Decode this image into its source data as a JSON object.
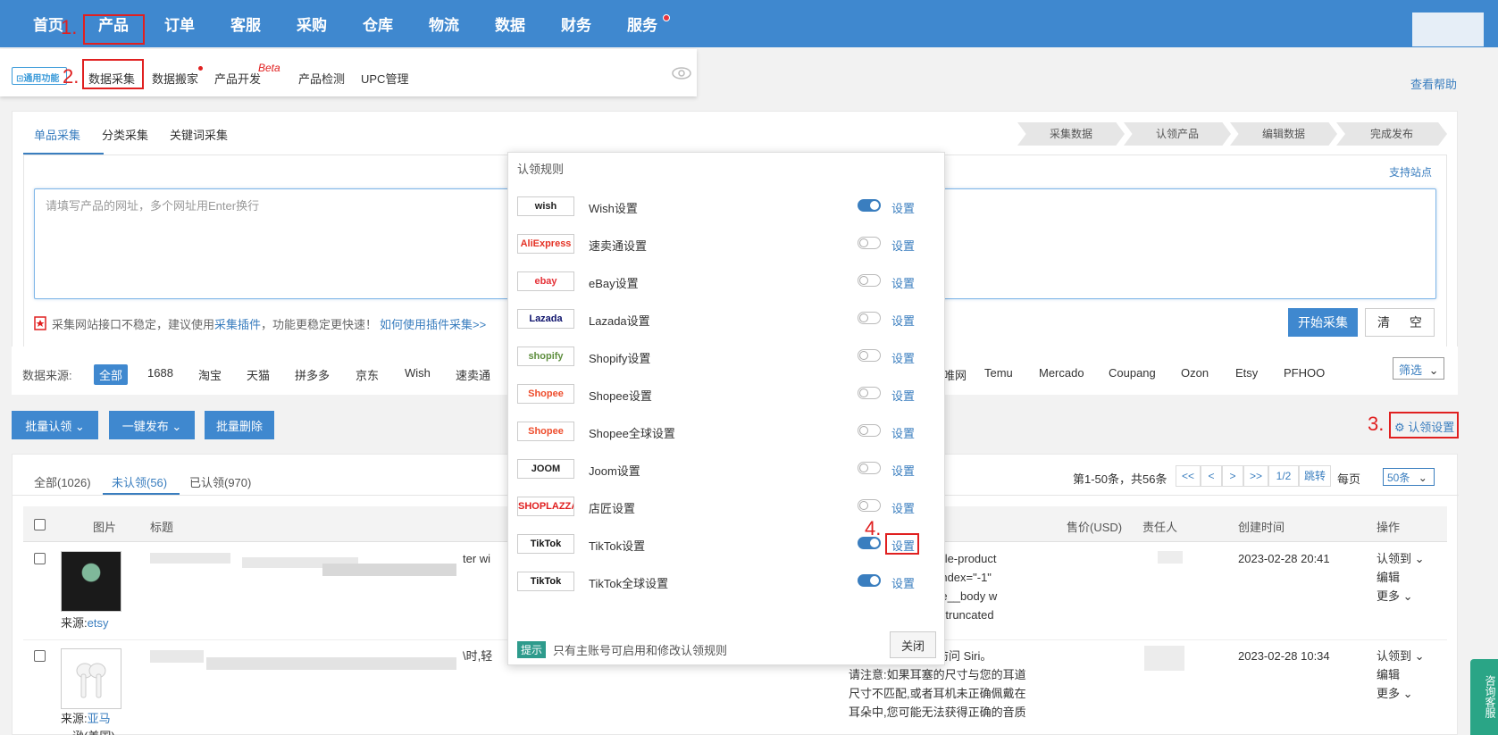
{
  "topnav": {
    "items": [
      "首页",
      "产品",
      "订单",
      "客服",
      "采购",
      "仓库",
      "物流",
      "数据",
      "财务",
      "服务"
    ]
  },
  "steps_markers": {
    "s1": "1.",
    "s2": "2.",
    "s3": "3.",
    "s4": "4."
  },
  "submenu": {
    "general_label": "通用功能",
    "items": [
      "数据采集",
      "数据搬家",
      "产品开发",
      "产品检测",
      "UPC管理"
    ],
    "beta": "Beta",
    "help": "查看帮助"
  },
  "collect": {
    "tabs": [
      "单品采集",
      "分类采集",
      "关键词采集"
    ],
    "steps": [
      "采集数据",
      "认领产品",
      "编辑数据",
      "完成发布"
    ],
    "supported_sites": "支持站点",
    "url_placeholder": "请填写产品的网址，多个网址用Enter换行",
    "notice_prefix": "采集网站接口不稳定，建议使用",
    "notice_link": "采集插件",
    "notice_suffix": "，功能更稳定更快速！",
    "notice_how": "如何使用插件采集>>",
    "start_btn": "开始采集",
    "clear_btn": "清 空"
  },
  "sources": {
    "label": "数据来源:",
    "items_left": [
      "全部",
      "1688",
      "淘宝",
      "天猫",
      "拼多多",
      "京东",
      "Wish",
      "速卖通"
    ],
    "items_right": [
      "唯网",
      "Temu",
      "Mercado",
      "Coupang",
      "Ozon",
      "Etsy",
      "PFHOO"
    ],
    "filter": "筛选"
  },
  "actions": {
    "batch_claim": "批量认领",
    "one_click_publish": "一键发布",
    "batch_delete": "批量删除",
    "claim_settings": "认领设置"
  },
  "list": {
    "tabs": [
      "全部(1026)",
      "未认领(56)",
      "已认领(970)"
    ],
    "page_info": "第1-50条，共56条",
    "pager": [
      "<<",
      "<",
      ">",
      ">>"
    ],
    "page_num": "1/2",
    "jump": "跳转",
    "per_page_label": "每页",
    "per_page_value": "50条",
    "headers": [
      "图片",
      "标题",
      "售价(USD)",
      "责任人",
      "创建时间",
      "操作"
    ],
    "rows": [
      {
        "source_label": "来源:",
        "source": "etsy",
        "title_fragment": "ter wi",
        "desc": [
          "oggle-product",
          "abindex=\"-1\"",
          "ggle__body w",
          "dy--truncated"
        ],
        "created": "2023-02-28 20:41",
        "ops": [
          "认领到",
          "编辑",
          "更多"
        ]
      },
      {
        "source_label": "来源:",
        "source": "亚马",
        "source_2": "逊(美国)",
        "title_fragment": "\\时,轻",
        "desc": [
          "速访问 Siri。",
          "请注意:如果耳塞的尺寸与您的耳道",
          "尺寸不匹配,或者耳机未正确佩戴在",
          "耳朵中,您可能无法获得正确的音质"
        ],
        "created": "2023-02-28 10:34",
        "ops": [
          "认领到",
          "编辑",
          "更多"
        ]
      }
    ]
  },
  "popup": {
    "title": "认领规则",
    "rules": [
      {
        "logo": "wish",
        "name": "Wish设置",
        "on": true,
        "set": "设置",
        "color": "#222222"
      },
      {
        "logo": "AliExpress",
        "name": "速卖通设置",
        "on": false,
        "set": "设置",
        "color": "#e43225"
      },
      {
        "logo": "ebay",
        "name": "eBay设置",
        "on": false,
        "set": "设置",
        "color": "#e53238"
      },
      {
        "logo": "Lazada",
        "name": "Lazada设置",
        "on": false,
        "set": "设置",
        "color": "#0f146d"
      },
      {
        "logo": "shopify",
        "name": "Shopify设置",
        "on": false,
        "set": "设置",
        "color": "#5e8e3e"
      },
      {
        "logo": "Shopee",
        "name": "Shopee设置",
        "on": false,
        "set": "设置",
        "color": "#ee4d2d"
      },
      {
        "logo": "Shopee",
        "name": "Shopee全球设置",
        "on": false,
        "set": "设置",
        "color": "#ee4d2d"
      },
      {
        "logo": "JOOM",
        "name": "Joom设置",
        "on": false,
        "set": "设置",
        "color": "#222222"
      },
      {
        "logo": "SHOPLAZZA",
        "name": "店匠设置",
        "on": false,
        "set": "设置",
        "color": "#e02020"
      },
      {
        "logo": "TikTok",
        "name": "TikTok设置",
        "on": true,
        "set": "设置",
        "color": "#111111"
      },
      {
        "logo": "TikTok",
        "name": "TikTok全球设置",
        "on": true,
        "set": "设置",
        "color": "#111111"
      }
    ],
    "tip_badge": "提示",
    "tip_text": "只有主账号可启用和修改认领规则",
    "close": "关闭"
  },
  "consult": "咨询客服"
}
